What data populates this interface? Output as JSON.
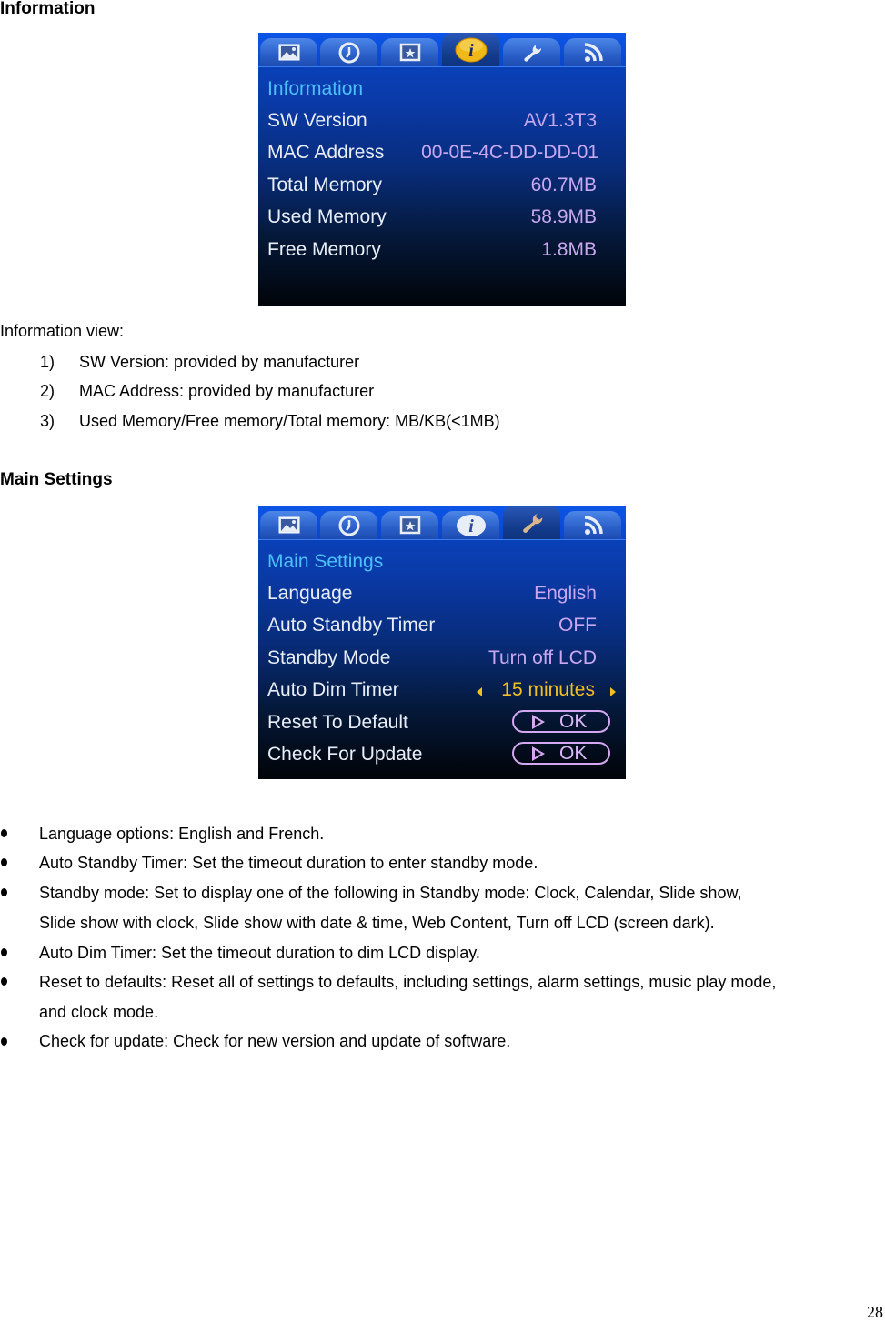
{
  "section1": {
    "heading": "Information",
    "screen": {
      "tabs": [
        {
          "icon": "photo-icon",
          "active": false
        },
        {
          "icon": "clock-icon",
          "active": false
        },
        {
          "icon": "star-frame-icon",
          "active": false
        },
        {
          "icon": "info-icon",
          "active": true
        },
        {
          "icon": "wrench-icon",
          "active": false
        },
        {
          "icon": "rss-icon",
          "active": false
        }
      ],
      "title": "Information",
      "rows": [
        {
          "label": "SW Version",
          "value": "AV1.3T3"
        },
        {
          "label": "MAC Address",
          "value": "00-0E-4C-DD-DD-01"
        },
        {
          "label": "Total Memory",
          "value": "60.7MB"
        },
        {
          "label": "Used Memory",
          "value": "58.9MB"
        },
        {
          "label": "Free Memory",
          "value": "1.8MB"
        }
      ]
    },
    "intro": "Information view:",
    "list": [
      {
        "num": "1)",
        "text": "SW Version: provided by manufacturer"
      },
      {
        "num": "2)",
        "text": "MAC Address: provided by manufacturer"
      },
      {
        "num": "3)",
        "text": "Used Memory/Free memory/Total memory: MB/KB(<1MB)"
      }
    ]
  },
  "section2": {
    "heading": "Main Settings",
    "screen": {
      "tabs": [
        {
          "icon": "photo-icon",
          "active": false
        },
        {
          "icon": "clock-icon",
          "active": false
        },
        {
          "icon": "star-frame-icon",
          "active": false
        },
        {
          "icon": "info-icon",
          "active": false
        },
        {
          "icon": "wrench-icon",
          "active": true
        },
        {
          "icon": "rss-icon",
          "active": false
        }
      ],
      "title": "Main Settings",
      "rows": [
        {
          "label": "Language",
          "value": "English"
        },
        {
          "label": "Auto Standby Timer",
          "value": "OFF"
        },
        {
          "label": "Standby Mode",
          "value": "Turn off LCD"
        },
        {
          "label": "Auto Dim Timer",
          "value": "15 minutes"
        },
        {
          "label": "Reset To Default",
          "button": "OK"
        },
        {
          "label": "Check For Update",
          "button": "OK"
        }
      ]
    },
    "bullets": [
      {
        "lines": [
          "Language options: English and French."
        ]
      },
      {
        "lines": [
          "Auto Standby Timer: Set the timeout duration to enter standby mode."
        ]
      },
      {
        "lines": [
          "Standby mode: Set to display one of the following in Standby mode: Clock, Calendar, Slide show,",
          "Slide show with clock, Slide show with date & time, Web Content, Turn off LCD (screen dark)."
        ]
      },
      {
        "lines": [
          "Auto Dim Timer: Set the timeout duration to dim LCD display."
        ]
      },
      {
        "lines": [
          "Reset to defaults: Reset all of settings to defaults, including settings, alarm settings, music play mode,",
          "and clock mode."
        ]
      },
      {
        "lines": [
          "Check for update: Check for new version and update of software."
        ]
      }
    ]
  },
  "page_number": "28"
}
